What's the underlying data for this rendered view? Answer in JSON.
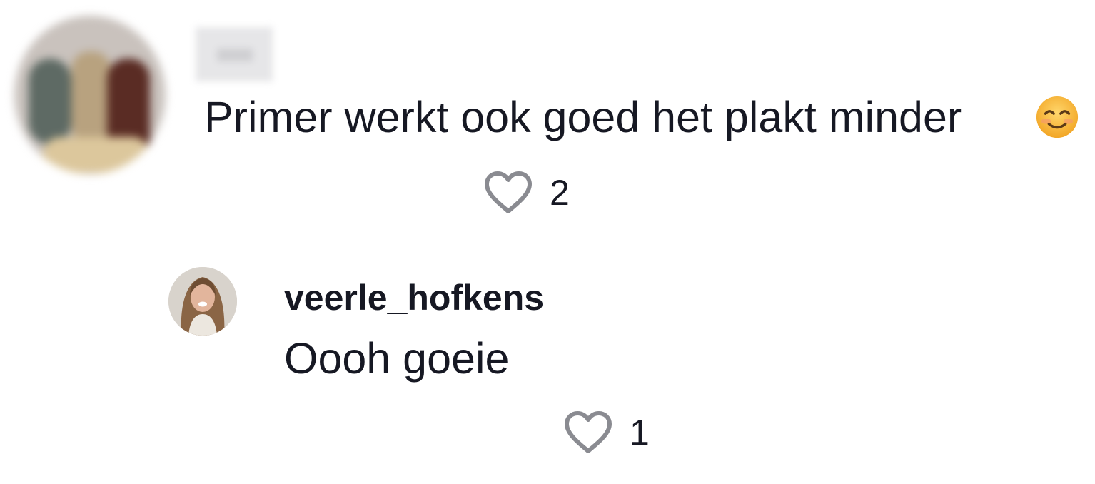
{
  "comment": {
    "avatar_icon": "blurred-avatar",
    "username_hidden": true,
    "text": "Primer werkt ook goed het plakt minder",
    "emoji_icon": "smiling-face-emoji",
    "like_icon": "heart-outline-icon",
    "like_count": "2"
  },
  "reply": {
    "avatar_icon": "user-avatar-photo",
    "username": "veerle_hofkens",
    "text": "Oooh goeie",
    "like_icon": "heart-outline-icon",
    "like_count": "1"
  },
  "colors": {
    "text": "#161823",
    "heart_stroke": "#8a8b91",
    "background": "#ffffff",
    "emoji_face": "#f7b733"
  }
}
